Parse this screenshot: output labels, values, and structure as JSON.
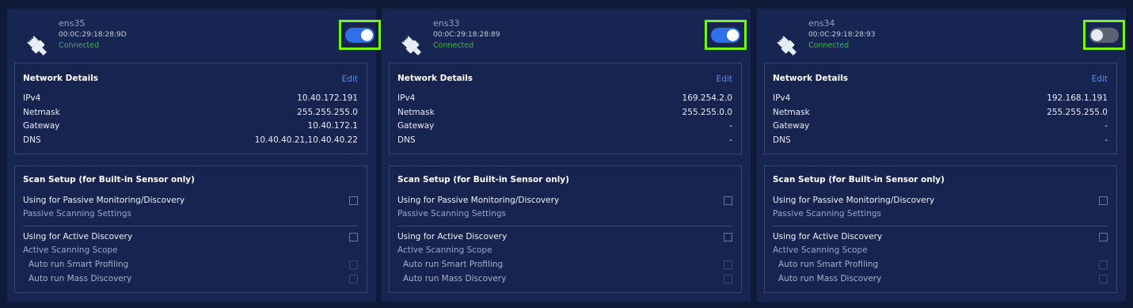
{
  "cards": [
    {
      "name": "ens35",
      "mac": "00:0C:29:18:28:9D",
      "status": "Connected",
      "enabled": true,
      "details_title": "Network Details",
      "edit_label": "Edit",
      "rows": [
        {
          "label": "IPv4",
          "value": "10.40.172.191"
        },
        {
          "label": "Netmask",
          "value": "255.255.255.0"
        },
        {
          "label": "Gateway",
          "value": "10.40.172.1"
        },
        {
          "label": "DNS",
          "value": "10.40.40.21,10.40.40.22"
        }
      ],
      "scan_title": "Scan Setup (for Built-in Sensor only)",
      "passive_label": "Using for Passive Monitoring/Discovery",
      "passive_settings": "Passive Scanning Settings",
      "active_label": "Using for Active Discovery",
      "active_scope": "Active Scanning Scope",
      "smart_profiling": "Auto run Smart Profiling",
      "mass_discovery": "Auto run Mass Discovery"
    },
    {
      "name": "ens33",
      "mac": "00:0C:29:18:28:89",
      "status": "Connected",
      "enabled": true,
      "details_title": "Network Details",
      "edit_label": "Edit",
      "rows": [
        {
          "label": "IPv4",
          "value": "169.254.2.0"
        },
        {
          "label": "Netmask",
          "value": "255.255.0.0"
        },
        {
          "label": "Gateway",
          "value": "-"
        },
        {
          "label": "DNS",
          "value": "-"
        }
      ],
      "scan_title": "Scan Setup (for Built-in Sensor only)",
      "passive_label": "Using for Passive Monitoring/Discovery",
      "passive_settings": "Passive Scanning Settings",
      "active_label": "Using for Active Discovery",
      "active_scope": "Active Scanning Scope",
      "smart_profiling": "Auto run Smart Profiling",
      "mass_discovery": "Auto run Mass Discovery"
    },
    {
      "name": "ens34",
      "mac": "00:0C:29:18:28:93",
      "status": "Connected",
      "enabled": false,
      "details_title": "Network Details",
      "edit_label": "Edit",
      "rows": [
        {
          "label": "IPv4",
          "value": "192.168.1.191"
        },
        {
          "label": "Netmask",
          "value": "255.255.255.0"
        },
        {
          "label": "Gateway",
          "value": "-"
        },
        {
          "label": "DNS",
          "value": "-"
        }
      ],
      "scan_title": "Scan Setup (for Built-in Sensor only)",
      "passive_label": "Using for Passive Monitoring/Discovery",
      "passive_settings": "Passive Scanning Settings",
      "active_label": "Using for Active Discovery",
      "active_scope": "Active Scanning Scope",
      "smart_profiling": "Auto run Smart Profiling",
      "mass_discovery": "Auto run Mass Discovery"
    }
  ],
  "icon": "ethernet-plug-icon",
  "colors": {
    "background": "#0f1a38",
    "card": "#172552",
    "accent_blue": "#2f6fe8",
    "connected_green": "#46b04f",
    "highlight_green": "#7cf21c",
    "link_blue": "#5c8ee8"
  }
}
